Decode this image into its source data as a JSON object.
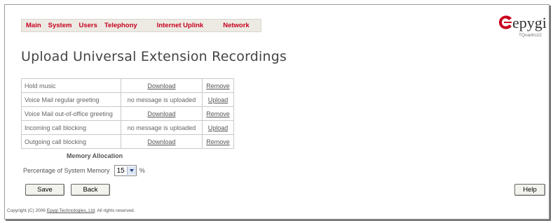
{
  "nav": {
    "items": [
      "Main",
      "System",
      "Users",
      "Telephony",
      "Internet Uplink",
      "Network"
    ]
  },
  "logo": {
    "word": "epygi",
    "model": "TQuadro22"
  },
  "page_title": "Upload Universal Extension Recordings",
  "recordings": [
    {
      "name": "Hold music",
      "status": "Download",
      "action": "Remove"
    },
    {
      "name": "Voice Mail regular greeting",
      "status": "no message is uploaded",
      "action": "Upload"
    },
    {
      "name": "Voice Mail out-of-office greeting",
      "status": "Download",
      "action": "Remove"
    },
    {
      "name": "Incoming call blocking",
      "status": "no message is uploaded",
      "action": "Upload"
    },
    {
      "name": "Outgoing call blocking",
      "status": "Download",
      "action": "Remove"
    }
  ],
  "memory": {
    "title": "Memory Allocation",
    "label": "Percentage of System Memory",
    "value": "15",
    "unit": "%"
  },
  "buttons": {
    "save": "Save",
    "back": "Back",
    "help": "Help"
  },
  "footer": {
    "prefix": "Copyright (C) 2006",
    "company": "Epygi Technologies, Ltd",
    "suffix": "All rights reserved."
  },
  "colors": {
    "nav_text": "#c8001e",
    "logo_red": "#c8001e"
  }
}
